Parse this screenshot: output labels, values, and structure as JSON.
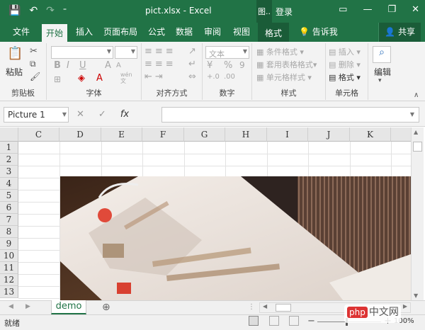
{
  "titlebar": {
    "title": "pict.xlsx - Excel",
    "context_label": "图..",
    "login": "登录",
    "qat_save": "💾",
    "qat_undo": "↶",
    "qat_redo": "↷",
    "qat_more": "⁼",
    "min": "—",
    "restore": "❐",
    "close": "✕"
  },
  "tabs": [
    "文件",
    "开始",
    "插入",
    "页面布局",
    "公式",
    "数据",
    "审阅",
    "视图"
  ],
  "context_tab": "格式",
  "tell_me": "告诉我",
  "share": "共享",
  "ribbon": {
    "clipboard": {
      "paste": "粘贴",
      "label": "剪贴板"
    },
    "font": {
      "label": "字体",
      "bold": "B",
      "italic": "I",
      "underline": "U",
      "grow": "A",
      "shrink": "A",
      "wen": "wén\n文"
    },
    "align": {
      "label": "对齐方式"
    },
    "number": {
      "format": "文本",
      "label": "数字",
      "percent": "%",
      "comma": "9"
    },
    "styles": {
      "cond": "条件格式",
      "table": "套用表格格式",
      "cell": "单元格样式",
      "label": "样式"
    },
    "cells": {
      "insert": "插入",
      "delete": "删除",
      "format": "格式",
      "label": "单元格"
    },
    "edit": {
      "label": "编辑"
    }
  },
  "formula": {
    "namebox": "Picture 1",
    "fx": "fx",
    "cancel": "✕",
    "enter": "✓"
  },
  "grid": {
    "columns": [
      "C",
      "D",
      "E",
      "F",
      "G",
      "H",
      "I",
      "J",
      "K"
    ],
    "rows": [
      "1",
      "2",
      "3",
      "4",
      "5",
      "6",
      "7",
      "8",
      "9",
      "10",
      "11",
      "12",
      "13"
    ]
  },
  "sheet": {
    "name": "demo",
    "add": "⊕"
  },
  "status": {
    "ready": "就绪",
    "zoom": "100%",
    "minus": "−",
    "plus": "+"
  },
  "watermark": "php中文网"
}
